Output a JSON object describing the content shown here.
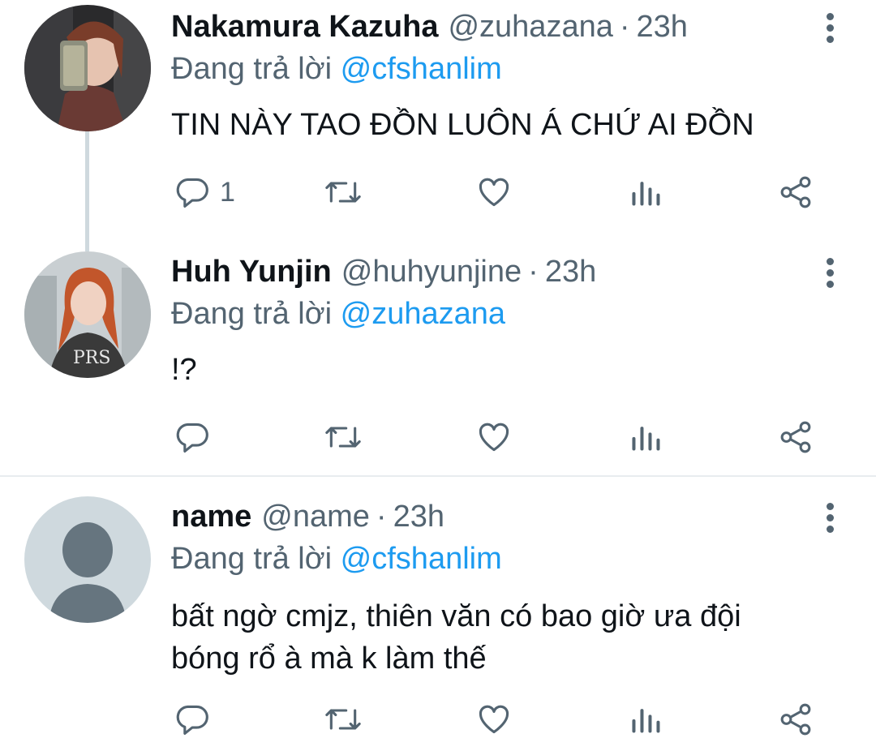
{
  "tweets": [
    {
      "name": "Nakamura Kazuha",
      "handle": "@zuhazana",
      "separator": "·",
      "time": "23h",
      "reply_prefix": "Đang trả lời",
      "reply_to": "@cfshanlim",
      "text": "TIN NÀY TAO ĐỒN LUÔN Á CHỨ AI ĐỒN",
      "reply_count": "1",
      "avatar": "profile-photo"
    },
    {
      "name": "Huh Yunjin",
      "handle": "@huhyunjine",
      "separator": "·",
      "time": "23h",
      "reply_prefix": "Đang trả lời",
      "reply_to": "@zuhazana",
      "text": "!?",
      "reply_count": "",
      "avatar": "profile-photo"
    },
    {
      "name": "name",
      "handle": "@name",
      "separator": "·",
      "time": "23h",
      "reply_prefix": "Đang trả lời",
      "reply_to": "@cfshanlim",
      "text": "bất ngờ cmjz, thiên văn có bao giờ ưa đội bóng rổ à mà k làm thế",
      "reply_count": "",
      "avatar": "default-person-placeholder"
    }
  ],
  "icons": [
    "reply-icon",
    "retweet-icon",
    "like-icon",
    "views-icon",
    "share-icon",
    "more-options-icon"
  ],
  "colors": {
    "link": "#1d9bf0",
    "secondary": "#536471",
    "text": "#0f1419",
    "thread_line": "#cfd9de"
  }
}
